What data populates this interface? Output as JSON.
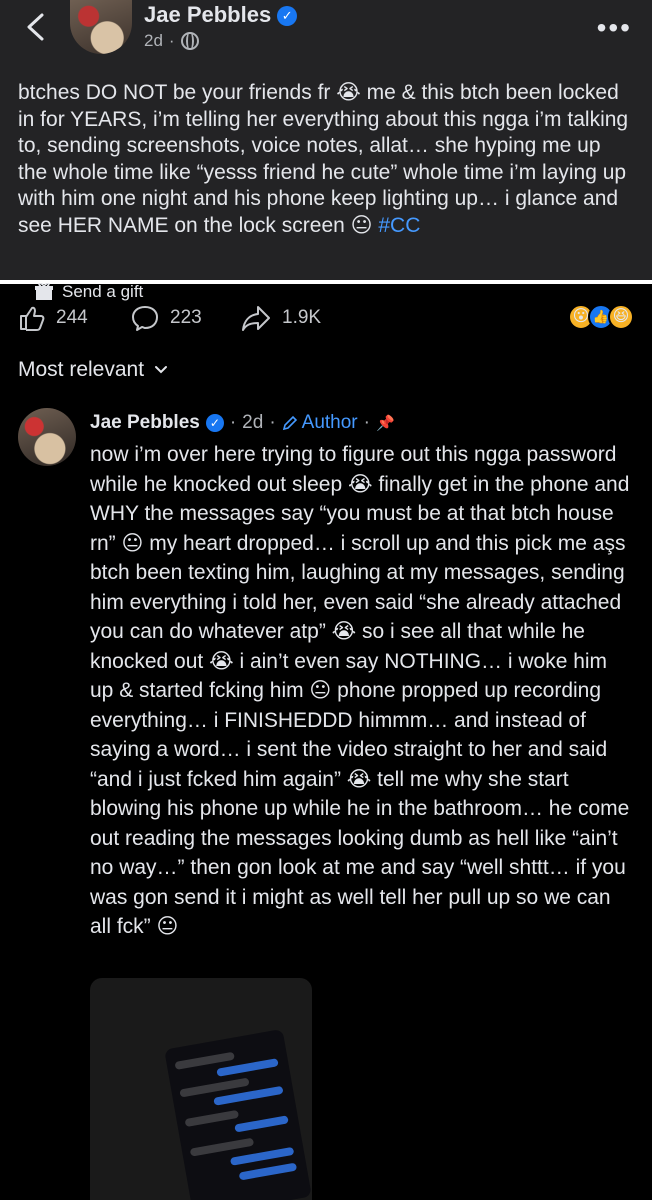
{
  "post": {
    "author": "Jae Pebbles",
    "time": "2d",
    "text": "btches DO NOT be your friends fr 😭 me & this btch been locked in for YEARS, i’m telling her everything about this ngga i’m talking to, sending screenshots, voice notes, allat… she hyping me up the whole time like “yesss friend he cute” whole time i’m laying up with him one night and his phone keep lighting up… i glance and see HER NAME on the lock screen 😐 ",
    "hashtag": "#CC"
  },
  "gift_label": "Send a gift",
  "actions": {
    "likes": "244",
    "comments": "223",
    "shares": "1.9K"
  },
  "reactions": [
    "wow",
    "like",
    "haha"
  ],
  "sort_label": "Most relevant",
  "comment": {
    "author": "Jae Pebbles",
    "time": "2d",
    "badge": "Author",
    "text": "now i’m over here trying to figure out this ngga password while he knocked out sleep 😭 finally get in the phone and WHY the messages say “you must be at that btch house rn” 😐 my heart dropped… i scroll up and this pick me aşs btch been texting him, laughing at my messages, sending him everything i told her, even said “she already attached you can do whatever atp” 😭 so i see all that while he knocked out 😭 i ain’t even say NOTHING… i woke him up & started fcking him 😐 phone propped up recording everything… i FINISHEDDD himmm… and instead of saying a word… i sent the video straight to her and said “and i just fcked him again” 😭 tell me why she start blowing his phone up while he in the bathroom… he come out reading the messages looking dumb as hell like “ain’t no way…” then gon look at me and say “well shttt… if you was gon send it i might as well tell her pull up so we can all fck” 😐"
  },
  "colors": {
    "card_bg": "#232325",
    "page_bg": "#000000",
    "link_blue": "#4599ff",
    "verified_blue": "#1877f2"
  }
}
